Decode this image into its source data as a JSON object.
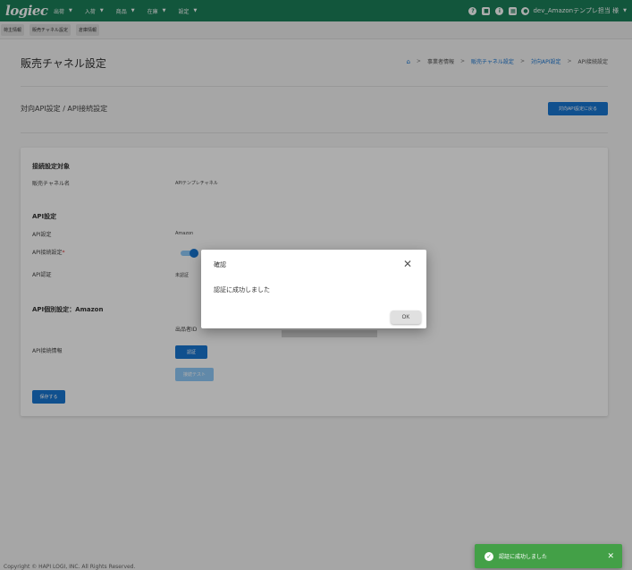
{
  "header": {
    "logo": "logiec",
    "nav": [
      "出荷",
      "入荷",
      "商品",
      "在庫",
      "設定"
    ],
    "icons": [
      "help-icon",
      "briefcase-icon",
      "info-icon",
      "calendar-icon",
      "account-icon"
    ],
    "user": "dev_Amazonテンプレ担当 様"
  },
  "tabs": [
    "荷主情報",
    "販売チャネル設定",
    "倉庫情報"
  ],
  "page": {
    "title": "販売チャネル設定",
    "breadcrumb": [
      "事業者情報",
      "販売チャネル設定",
      "対向API設定",
      "API接続設定"
    ],
    "subtitle": "対向API設定 / API接続設定",
    "back_button": "対向API設定に戻る"
  },
  "form": {
    "section1": "接続設定対象",
    "channel_label": "販売チャネル名",
    "channel_value": "APIテンプレチャネル",
    "section2": "API設定",
    "api_label": "API設定",
    "api_value": "Amazon",
    "connection_label": "API接続設定",
    "connection_required": "*",
    "connection_enabled": true,
    "auth_label": "API認証",
    "auth_value": "未認証",
    "section3": "API個別設定：Amazon",
    "seller_label": "出品者ID",
    "connection_info_label": "API接続情報",
    "auth_button": "認証",
    "disabled_button": "接続テスト",
    "save_button": "保存する"
  },
  "dialog": {
    "title": "確認",
    "message": "認証に成功しました",
    "ok": "OK"
  },
  "toast": {
    "message": "認証に成功しました"
  },
  "footer": "Copyright © HAPI LOGI, INC. All Rights Reserved.",
  "colors": {
    "topbar": "#1b7f59",
    "primary": "#1976d2",
    "success": "#43a047"
  }
}
